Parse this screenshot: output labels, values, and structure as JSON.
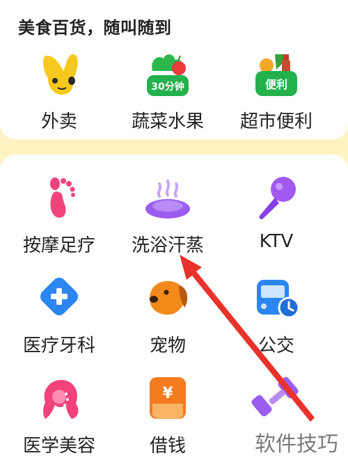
{
  "section": {
    "title": "美食百货，随叫随到"
  },
  "top_items": [
    {
      "label": "外卖",
      "icon": "kangaroo-icon"
    },
    {
      "label": "蔬菜水果",
      "icon": "vegetable-basket-icon",
      "badge": "30分钟"
    },
    {
      "label": "超市便利",
      "icon": "grocery-basket-icon",
      "badge": "便利"
    }
  ],
  "grid_items": [
    {
      "label": "按摩足疗",
      "icon": "footprint-icon"
    },
    {
      "label": "洗浴汗蒸",
      "icon": "bath-steam-icon"
    },
    {
      "label": "KTV",
      "icon": "microphone-icon"
    },
    {
      "label": "医疗牙科",
      "icon": "medical-cross-icon"
    },
    {
      "label": "宠物",
      "icon": "dog-icon"
    },
    {
      "label": "公交",
      "icon": "bus-clock-icon"
    },
    {
      "label": "医学美容",
      "icon": "beauty-woman-icon"
    },
    {
      "label": "借钱",
      "icon": "yen-wallet-icon",
      "badge": "¥"
    },
    {
      "label": "",
      "icon": "dumbbell-icon"
    }
  ],
  "watermark": {
    "text": "软件技巧"
  },
  "colors": {
    "background": "#fdf3c2",
    "card": "#ffffff",
    "text": "#222222",
    "arrow": "#e8322b",
    "green": "#22b14c",
    "yellow": "#f7c81e",
    "pink": "#f1437a",
    "purple": "#9b5cf0",
    "blue": "#2b86f3",
    "orange": "#f28a1b"
  }
}
